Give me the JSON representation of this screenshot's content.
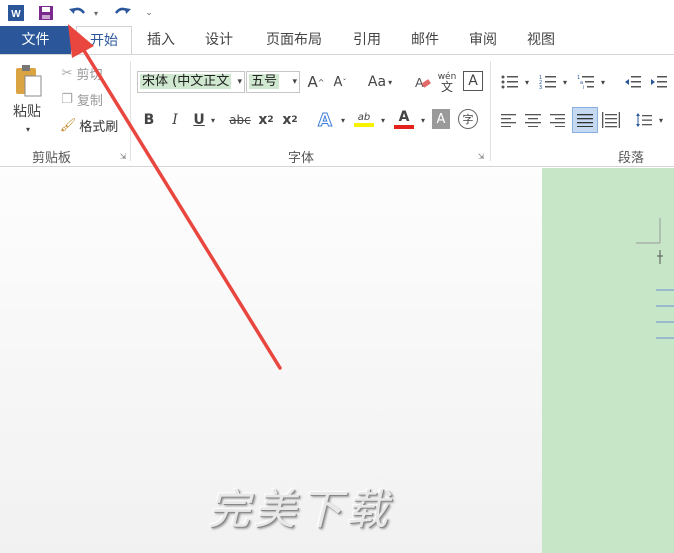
{
  "quick_access": {
    "app_icon": "word-icon",
    "save_icon": "save-icon",
    "undo_icon": "undo-icon",
    "redo_icon": "redo-icon",
    "customize_icon": "customize-qat-icon"
  },
  "tabs": {
    "file": "文件",
    "home": "开始",
    "insert": "插入",
    "design": "设计",
    "layout": "页面布局",
    "references": "引用",
    "mailings": "邮件",
    "review": "审阅",
    "view": "视图"
  },
  "clipboard": {
    "paste": "粘贴",
    "cut": "剪切",
    "copy": "复制",
    "format_painter": "格式刷",
    "group_label": "剪贴板"
  },
  "font": {
    "font_name": "宋体 (中文正文",
    "font_size": "五号",
    "grow": "A",
    "shrink": "A",
    "change_case": "Aa",
    "phonetic_top": "wén",
    "phonetic_bottom": "文",
    "border_char": "A",
    "bold": "B",
    "italic": "I",
    "underline": "U",
    "strikethrough": "abc",
    "subscript": "x",
    "superscript": "x",
    "sub_mark": "2",
    "sup_mark": "2",
    "text_effects": "A",
    "highlight": "ab",
    "font_color": "A",
    "char_shading": "A",
    "enclose": "字",
    "group_label": "字体"
  },
  "paragraph": {
    "group_label": "段落"
  },
  "watermark": "完美下载",
  "colors": {
    "file_tab": "#2b579a",
    "doc_green": "#c7e6c8",
    "arrow": "#e8463f",
    "highlight_yellow": "#f7f300",
    "font_red": "#e3221c"
  }
}
